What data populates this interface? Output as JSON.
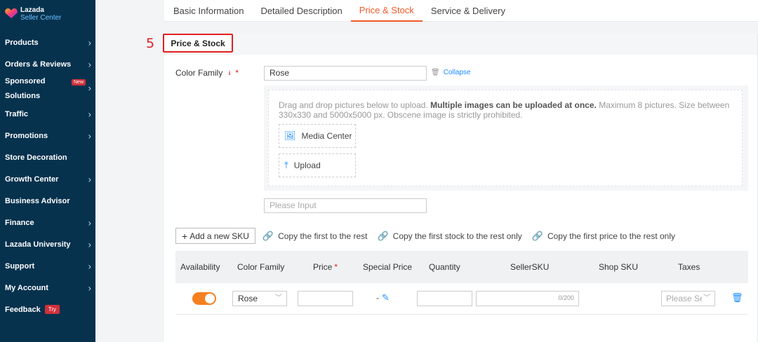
{
  "sidebar": {
    "logo": {
      "name": "Lazada",
      "subtitle": "Seller Center"
    },
    "items": [
      {
        "label": "Products",
        "chevron": true
      },
      {
        "label": "Orders & Reviews",
        "chevron": true
      },
      {
        "label": "Sponsored Solutions",
        "chevron": true,
        "badge": "New"
      },
      {
        "label": "Traffic",
        "chevron": true
      },
      {
        "label": "Promotions",
        "chevron": true
      },
      {
        "label": "Store Decoration",
        "chevron": false
      },
      {
        "label": "Growth Center",
        "chevron": true
      },
      {
        "label": "Business Advisor",
        "chevron": false
      },
      {
        "label": "Finance",
        "chevron": true
      },
      {
        "label": "Lazada University",
        "chevron": true
      },
      {
        "label": "Support",
        "chevron": true
      },
      {
        "label": "My Account",
        "chevron": true
      },
      {
        "label": "Feedback",
        "chevron": false,
        "badge": "Try"
      }
    ]
  },
  "tabs": [
    "Basic Information",
    "Detailed Description",
    "Price & Stock",
    "Service & Delivery"
  ],
  "active_tab": "Price & Stock",
  "step_number": "5",
  "section_title": "Price & Stock",
  "color_family": {
    "label": "Color Family",
    "value": "Rose",
    "collapse_label": "Collapse"
  },
  "upload": {
    "text_before": "Drag and drop pictures below to upload. ",
    "text_bold": "Multiple images can be uploaded at once.",
    "text_after": " Maximum 8 pictures. Size between 330x330 and 5000x5000 px. Obscene image is strictly prohibited.",
    "media_center_label": "Media Center",
    "upload_label": "Upload"
  },
  "new_color_input": {
    "placeholder": "Please Input"
  },
  "sku_actions": {
    "add_label": "Add a new SKU",
    "copy_rest": "Copy the first to the rest",
    "copy_stock": "Copy the first stock to the rest only",
    "copy_price": "Copy the first price to the rest only"
  },
  "table": {
    "headers": [
      "Availability",
      "Color Family",
      "Price",
      "Special Price",
      "Quantity",
      "SellerSKU",
      "Shop SKU",
      "Taxes"
    ],
    "row": {
      "availability_on": true,
      "color_family": "Rose",
      "special_price": "-",
      "seller_sku_counter": "0/200",
      "taxes_placeholder": "Please Se"
    }
  },
  "colors": {
    "sidebar_bg": "#06324e",
    "accent": "#f05a28",
    "link": "#1a8cff",
    "highlight_box": "#e02020",
    "toggle_on": "#f5801f"
  }
}
